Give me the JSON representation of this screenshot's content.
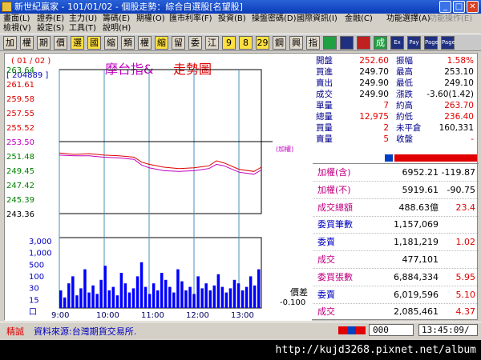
{
  "window": {
    "title": "新世紀贏家 - 101/01/02 - 個股走勢：綜合自選股[名望股]"
  },
  "menu": {
    "row1": [
      "畫面(L)",
      "證券(E)",
      "主力(U)",
      "籌碼(E)",
      "期權(O)",
      "匯市利率(F)",
      "投資(B)",
      "操盤密碼(D)",
      "國際資訊(I)",
      "金融(C)",
      "功能選擇(A)",
      "功能操作(E)"
    ],
    "row2": [
      "檢視(V)",
      "設定(S)",
      "工具(T)",
      "說明(H)"
    ]
  },
  "toolbar": {
    "items": [
      "加",
      "權",
      "期",
      "價",
      "選",
      "國",
      "縮",
      "類",
      "權",
      "縮",
      "留",
      "委",
      "江",
      "9",
      "8",
      "29",
      "鋼",
      "興",
      "指",
      "",
      "",
      "",
      "成",
      "Ex",
      "Pay",
      "Page",
      "Page"
    ]
  },
  "chart": {
    "date_label": "( 01 / 02 )",
    "volume_label": "[ 204889 ]",
    "title_part1": "摩台指&",
    "title_part2": "走勢圖",
    "ref_tag": "(加權)",
    "spread_label": "價差",
    "spread_value": "-0.100",
    "colors": {
      "up": "#e00000",
      "down": "#008000",
      "ref": "#000000",
      "axis": "#000000",
      "grid": "#4a90b8",
      "price": "#e00000",
      "index": "#c000c0",
      "volume": "#0000ff"
    }
  },
  "chart_data": {
    "type": "line",
    "ylim": [
      243.36,
      263.64
    ],
    "reference": 253.5,
    "yticks": [
      "263.64",
      "261.61",
      "259.58",
      "257.55",
      "255.52",
      "253.50",
      "251.48",
      "249.45",
      "247.42",
      "245.39",
      "243.36"
    ],
    "xticks": [
      "9:00",
      "10:00",
      "11:00",
      "12:00",
      "13:00"
    ],
    "x_minutes": [
      0,
      20,
      40,
      60,
      80,
      100,
      110,
      120,
      140,
      160,
      180,
      200,
      210,
      220,
      240,
      260,
      270
    ],
    "series": [
      {
        "values": [
          251.9,
          251.7,
          251.8,
          251.6,
          251.5,
          251.3,
          250.6,
          250.3,
          249.9,
          249.7,
          249.8,
          250.1,
          250.8,
          250.5,
          249.6,
          249.3,
          249.9
        ]
      },
      {
        "values": [
          251.6,
          251.5,
          251.5,
          251.3,
          251.2,
          251.0,
          250.2,
          249.8,
          249.4,
          249.3,
          249.4,
          249.7,
          250.3,
          250.1,
          249.2,
          248.9,
          249.5
        ]
      }
    ],
    "volume_yticks": [
      "3,000",
      "1,000",
      "500",
      "100",
      "30",
      "15",
      "口"
    ],
    "volume_levels": [
      0.25,
      0.15,
      0.35,
      0.45,
      0.18,
      0.28,
      0.55,
      0.22,
      0.32,
      0.2,
      0.4,
      0.6,
      0.25,
      0.3,
      0.18,
      0.5,
      0.35,
      0.22,
      0.28,
      0.45,
      0.65,
      0.3,
      0.2,
      0.35,
      0.25,
      0.5,
      0.4,
      0.3,
      0.22,
      0.55,
      0.38,
      0.25,
      0.3,
      0.2,
      0.45,
      0.28,
      0.35,
      0.25,
      0.32,
      0.48,
      0.3,
      0.22,
      0.28,
      0.4,
      0.35,
      0.25,
      0.3,
      0.45,
      0.32,
      0.55
    ]
  },
  "quote": {
    "rows": [
      {
        "l1": "開盤",
        "v1": "252.60",
        "l2": "振幅",
        "v2": "1.58%",
        "c1": "red",
        "c2": "red"
      },
      {
        "l1": "買進",
        "v1": "249.70",
        "l2": "最高",
        "v2": "253.10",
        "c1": "blk",
        "c2": "blk"
      },
      {
        "l1": "賣出",
        "v1": "249.90",
        "l2": "最低",
        "v2": "249.10",
        "c1": "blk",
        "c2": "blk"
      },
      {
        "l1": "成交",
        "v1": "249.90",
        "l2": "漲跌",
        "v2": "-3.60(1.42)",
        "c1": "blk",
        "c2": "blk"
      },
      {
        "l1": "單量",
        "v1": "7",
        "l2": "約高",
        "v2": "263.70",
        "c1": "red",
        "c2": "red"
      },
      {
        "l1": "總量",
        "v1": "12,975",
        "l2": "約低",
        "v2": "236.40",
        "c1": "red",
        "c2": "red"
      },
      {
        "l1": "買量",
        "v1": "2",
        "l2": "未平倉",
        "v2": "160,331",
        "c1": "red",
        "c2": "blk"
      },
      {
        "l1": "賣量",
        "v1": "5",
        "l2": "收盤",
        "v2": "-",
        "c1": "red",
        "c2": "red"
      }
    ]
  },
  "stats": {
    "rows": [
      {
        "label": "加權(含)",
        "value": "6952.21",
        "change": "-119.87",
        "lc": "mag",
        "cc": "blk"
      },
      {
        "label": "加權(不)",
        "value": "5919.61",
        "change": "-90.75",
        "lc": "mag",
        "cc": "blk"
      },
      {
        "label": "成交總額",
        "value": "488.63億",
        "change": "23.4",
        "lc": "mag",
        "cc": "red"
      },
      {
        "label": "委買筆數",
        "value": "1,157,069",
        "change": "",
        "lc": "blu",
        "cc": "blk"
      },
      {
        "label": "委賣",
        "value": "1,181,219",
        "change": "1.02",
        "lc": "blu",
        "cc": "red"
      },
      {
        "label": "成交",
        "value": "477,101",
        "change": "",
        "lc": "mag",
        "cc": "blk"
      },
      {
        "label": "委買張數",
        "value": "6,884,334",
        "change": "5.95",
        "lc": "mag",
        "cc": "red"
      },
      {
        "label": "委賣",
        "value": "6,019,596",
        "change": "5.10",
        "lc": "blu",
        "cc": "red"
      },
      {
        "label": "成交",
        "value": "2,085,461",
        "change": "4.37",
        "lc": "mag",
        "cc": "red"
      }
    ]
  },
  "status": {
    "tag": "精誠",
    "source": "資料來源:台灣期貨交易所.",
    "input_value": "000",
    "time": "13:45:09/"
  },
  "footer": {
    "url": "http://kujd3268.pixnet.net/album"
  }
}
